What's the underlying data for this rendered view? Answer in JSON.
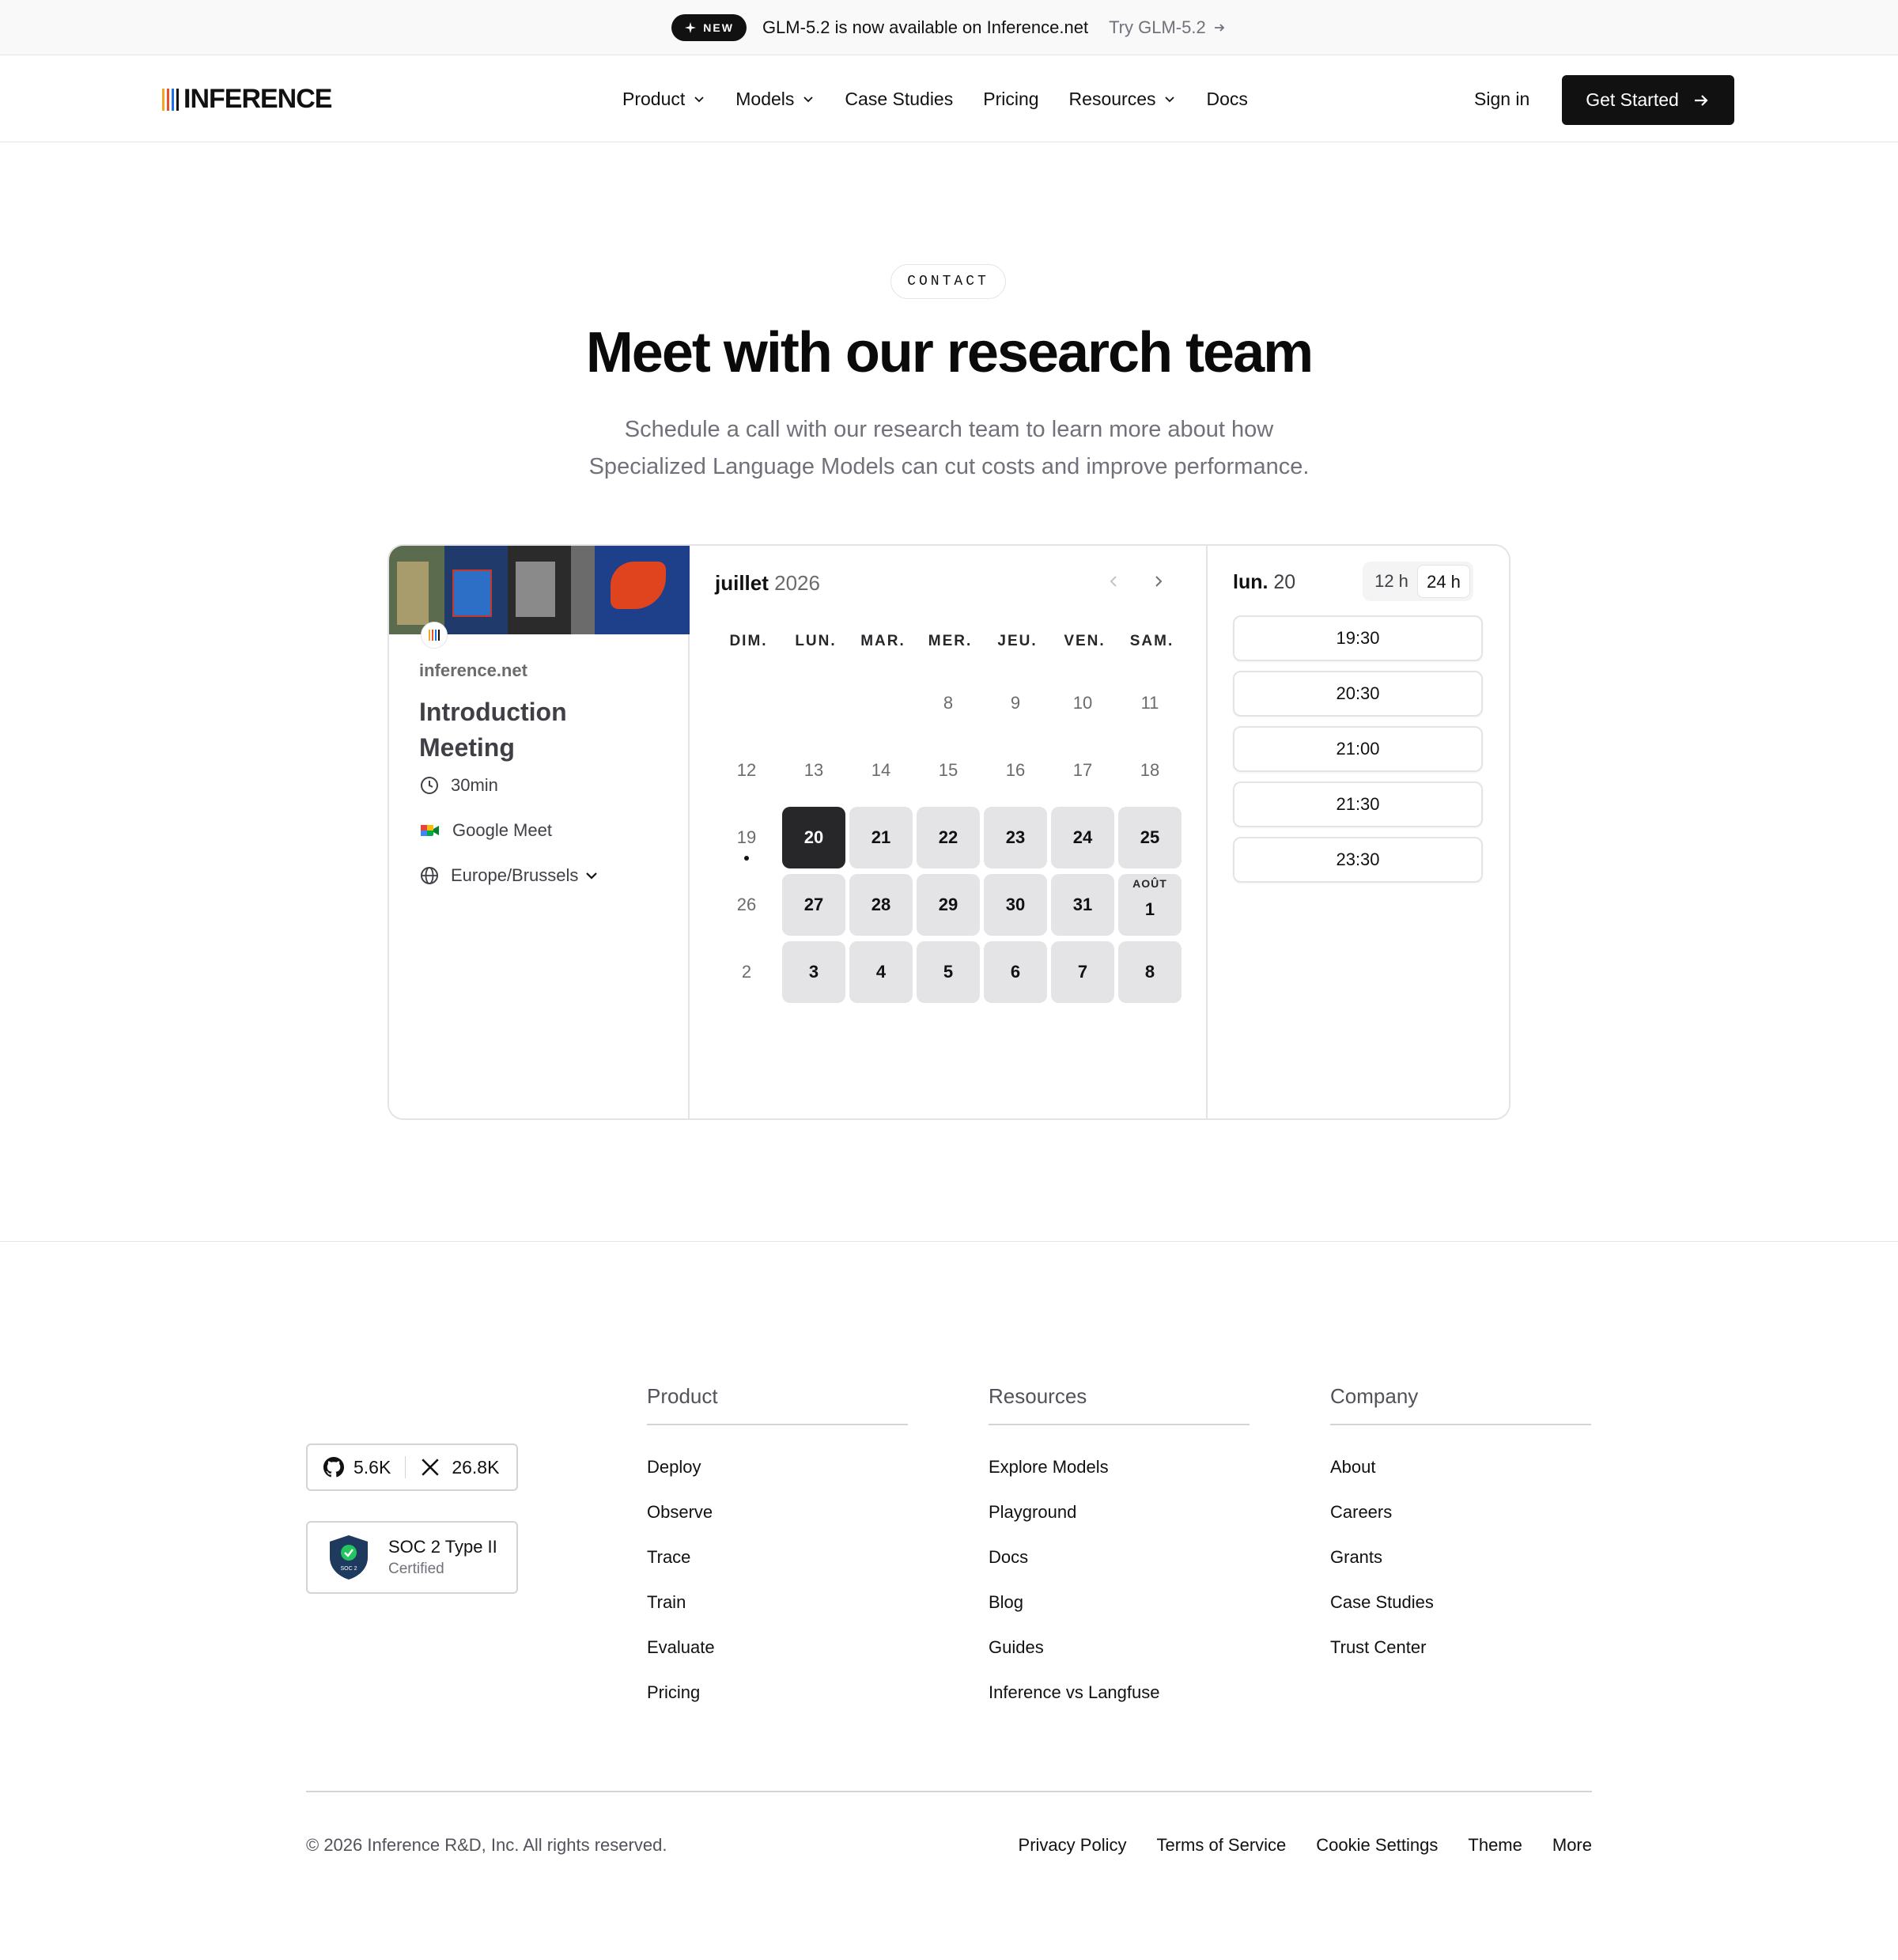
{
  "announcement": {
    "badge": "NEW",
    "message": "GLM-5.2 is now available on Inference.net",
    "cta": "Try GLM-5.2"
  },
  "nav": {
    "logo": "INFERENCE",
    "links": [
      "Product",
      "Models",
      "Case Studies",
      "Pricing",
      "Resources",
      "Docs"
    ],
    "sign_in": "Sign in",
    "get_started": "Get Started"
  },
  "hero": {
    "pill": "CONTACT",
    "title": "Meet with our research team",
    "subtitle_line1": "Schedule a call with our research team to learn more about how",
    "subtitle_line2": "Specialized Language Models can cut costs and improve performance."
  },
  "booking": {
    "org": "inference.net",
    "title": "Introduction Meeting",
    "duration": "30min",
    "location": "Google Meet",
    "timezone": "Europe/Brussels",
    "month": "juillet",
    "year": "2026",
    "weekdays": [
      "DIM.",
      "LUN.",
      "MAR.",
      "MER.",
      "JEU.",
      "VEN.",
      "SAM."
    ],
    "next_month_label": "AOÛT",
    "weeks": [
      [
        "",
        "",
        "",
        "8",
        "9",
        "10",
        "11"
      ],
      [
        "12",
        "13",
        "14",
        "15",
        "16",
        "17",
        "18"
      ],
      [
        "19",
        "20",
        "21",
        "22",
        "23",
        "24",
        "25"
      ],
      [
        "26",
        "27",
        "28",
        "29",
        "30",
        "31",
        "1"
      ],
      [
        "2",
        "3",
        "4",
        "5",
        "6",
        "7",
        "8"
      ]
    ],
    "selected_day": "20",
    "slot_day_name": "lun.",
    "slot_day_num": "20",
    "format_12": "12 h",
    "format_24": "24 h",
    "slots": [
      "19:30",
      "20:30",
      "21:00",
      "21:30",
      "23:30"
    ]
  },
  "footer": {
    "github_stars": "5.6K",
    "x_followers": "26.8K",
    "soc_title": "SOC 2 Type II",
    "soc_sub": "Certified",
    "soc_badge_text": "SOC 2",
    "columns": [
      {
        "title": "Product",
        "links": [
          "Deploy",
          "Observe",
          "Trace",
          "Train",
          "Evaluate",
          "Pricing"
        ]
      },
      {
        "title": "Resources",
        "links": [
          "Explore Models",
          "Playground",
          "Docs",
          "Blog",
          "Guides",
          "Inference vs Langfuse"
        ]
      },
      {
        "title": "Company",
        "links": [
          "About",
          "Careers",
          "Grants",
          "Case Studies",
          "Trust Center"
        ]
      }
    ],
    "copyright": "© 2026 Inference R&D, Inc. All rights reserved.",
    "legal": [
      "Privacy Policy",
      "Terms of Service",
      "Cookie Settings",
      "Theme",
      "More"
    ]
  },
  "colors": {
    "logo_bars": [
      "#f5a623",
      "#e8512a",
      "#1a73e8",
      "#111111"
    ],
    "selected_day": "#27272a",
    "available_day": "#e4e4e7"
  }
}
